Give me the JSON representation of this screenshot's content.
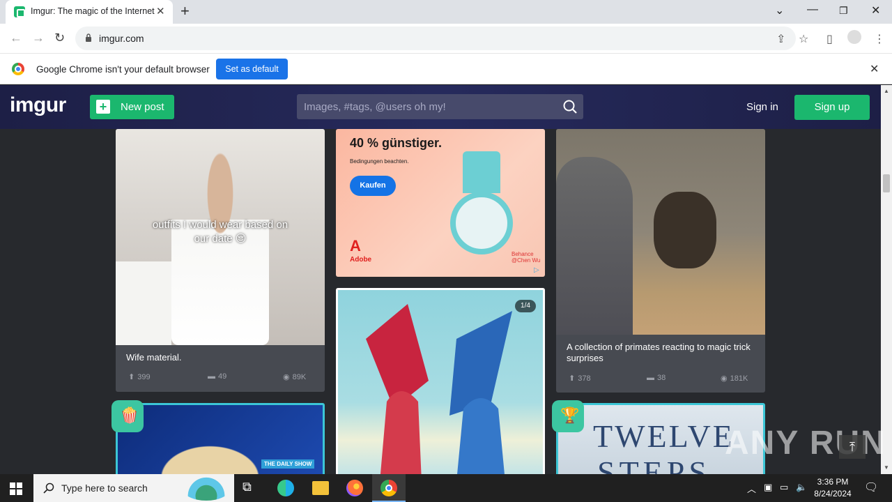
{
  "browser": {
    "tab_title": "Imgur: The magic of the Internet",
    "url": "imgur.com"
  },
  "infobar": {
    "message": "Google Chrome isn't your default browser",
    "button": "Set as default"
  },
  "header": {
    "logo": "imgur",
    "new_post": "New post",
    "search_placeholder": "Images, #tags, @users oh my!",
    "sign_in": "Sign in",
    "sign_up": "Sign up"
  },
  "posts": [
    {
      "overlay_text": "outfits I would wear based on our date 😌",
      "caption": "Wife material.",
      "upvotes": "399",
      "comments": "49",
      "views": "89K"
    },
    {
      "ad_line1": "40 % günstiger.",
      "ad_line2": "Bedingungen beachten.",
      "ad_button": "Kaufen",
      "ad_brand": "Adobe",
      "ad_credit": "Behance\n@Chen Wu"
    },
    {
      "counter": "1/4"
    },
    {
      "caption": "A collection of primates reacting to magic trick surprises",
      "upvotes": "378",
      "comments": "38",
      "views": "181K"
    },
    {
      "tag": "THE DAILY SHOW"
    },
    {
      "book_title_1": "TWELVE",
      "book_title_2": "STEPS"
    }
  ],
  "taskbar": {
    "search_placeholder": "Type here to search",
    "time": "3:36 PM",
    "date": "8/24/2024"
  },
  "watermark": "ANY RUN",
  "colors": {
    "imgur_green": "#1bb76e",
    "header_bg": "#1d1f46",
    "page_bg": "#27292d",
    "card_bg": "#474a51",
    "chrome_blue": "#1a73e8"
  }
}
